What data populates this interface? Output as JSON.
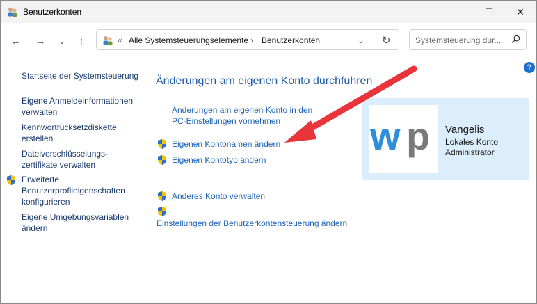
{
  "window": {
    "title": "Benutzerkonten"
  },
  "window_controls": {
    "minimize": "—",
    "maximize": "☐",
    "close": "✕"
  },
  "nav": {
    "back": "←",
    "forward": "→",
    "recent": "⌄",
    "up": "↑"
  },
  "address": {
    "chevron": "«",
    "crumb1": "Alle Systemsteuerungselemente",
    "separator": "›",
    "crumb2": "Benutzerkonten",
    "dropdown": "⌄",
    "refresh": "↻"
  },
  "search": {
    "placeholder": "Systemsteuerung dur...",
    "icon": "⌕"
  },
  "help": {
    "label": "?"
  },
  "sidebar": {
    "home": "Startseite der Systemsteuerung",
    "items": [
      {
        "line1": "Eigene Anmeldeinformationen",
        "line2": "verwalten"
      },
      {
        "line1": "Kennwortrücksetzdiskette",
        "line2": "erstellen"
      },
      {
        "line1": "Dateiverschlüsselungs-",
        "line2": "zertifikate verwalten"
      },
      {
        "line1": "Erweiterte",
        "line2": "Benutzerprofileigenschaften",
        "line3": "konfigurieren"
      },
      {
        "line1": "Eigene Umgebungsvariablen",
        "line2": "ändern"
      }
    ]
  },
  "main": {
    "heading": "Änderungen am eigenen Konto durchführen",
    "pc_settings_line1": "Änderungen am eigenen Konto in den",
    "pc_settings_line2": "PC-Einstellungen vornehmen",
    "rename": "Eigenen Kontonamen ändern",
    "change_type": "Eigenen Kontotyp ändern",
    "manage_other": "Anderes Konto verwalten",
    "uac": "Einstellungen der Benutzerkontensteuerung ändern"
  },
  "user": {
    "name": "Vangelis",
    "type": "Lokales Konto",
    "role": "Administrator",
    "logo_text": "wp"
  },
  "colors": {
    "arrow": "#e8343a",
    "link": "#1e63b5",
    "logo_w": "#2f8ed8",
    "logo_p": "#7a7a7a"
  }
}
